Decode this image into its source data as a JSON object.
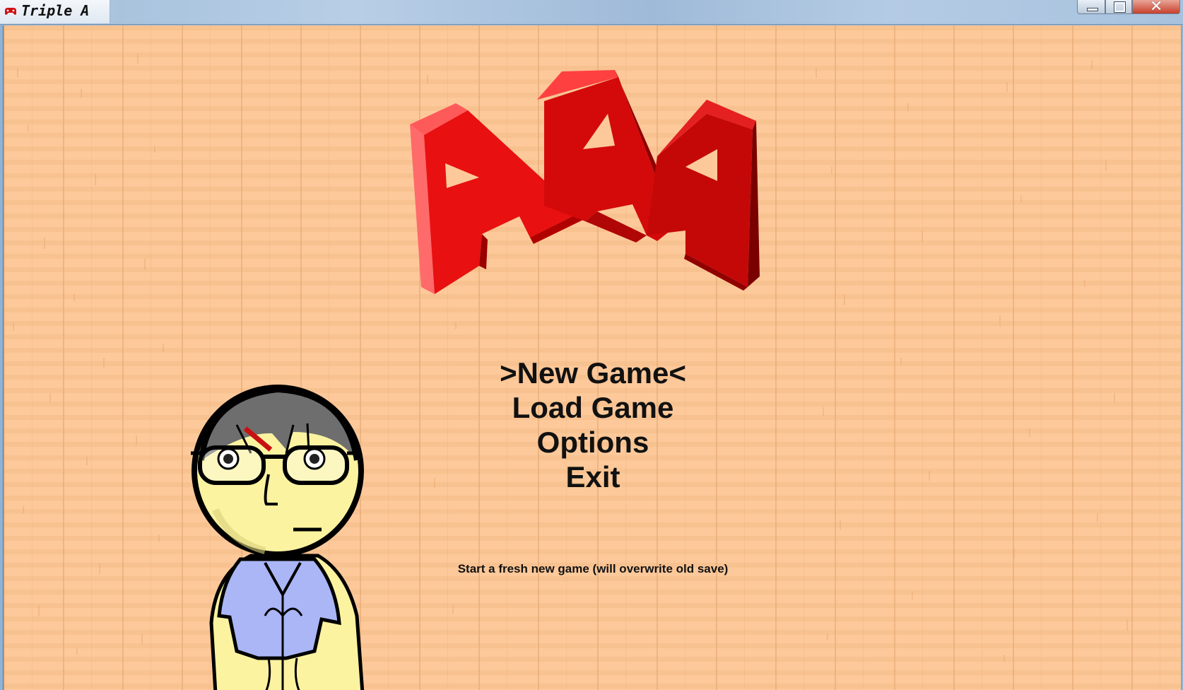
{
  "window": {
    "title": "Triple A",
    "icon": "red-controller-icon",
    "controls": [
      "minimize-icon",
      "maximize-icon",
      "close-icon"
    ]
  },
  "logo": {
    "text": "AAA",
    "colors": {
      "primary": "#e81010",
      "mid": "#cc0a0a",
      "dark": "#8e0000"
    }
  },
  "menu": {
    "items": [
      ">New Game<",
      "Load Game",
      "Options",
      "Exit"
    ],
    "selected_index": 0
  },
  "hint": "Start a fresh new game (will overwrite old save)",
  "character": {
    "name": "player-character",
    "skin": "#fbf3a0",
    "hair": "#6e6e6e",
    "shirt": "#aab6f6"
  },
  "background": {
    "color": "#fdc99a",
    "style": "wood-plank"
  }
}
